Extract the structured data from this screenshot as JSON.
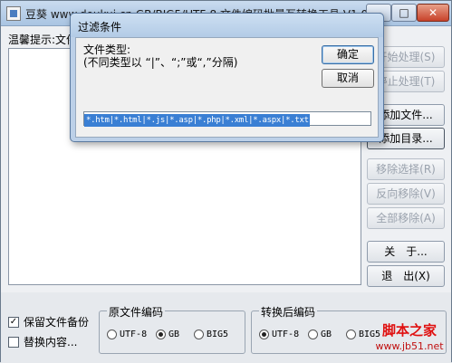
{
  "main_window": {
    "title": "豆葵 www.doukui.cn GB/BIG5/UTF-8 文件编码批量互转换工具 V1.0",
    "controls": {
      "minimize": "–",
      "maximize": "□",
      "close": "✕"
    },
    "hint_label": "温馨提示:文件",
    "side_buttons": [
      {
        "label": "开始处理(S)",
        "enabled": false
      },
      {
        "label": "停止处理(T)",
        "enabled": false
      },
      {
        "label": "添加文件...",
        "enabled": true
      },
      {
        "label": "添加目录...",
        "enabled": true
      },
      {
        "label": "移除选择(R)",
        "enabled": false
      },
      {
        "label": "反向移除(V)",
        "enabled": false
      },
      {
        "label": "全部移除(A)",
        "enabled": false
      },
      {
        "label": "关　于...",
        "enabled": true
      },
      {
        "label": "退　出(X)",
        "enabled": true
      }
    ],
    "options": {
      "backup": {
        "label": "保留文件备份",
        "checked": true
      },
      "replace": {
        "label": "替换内容...",
        "checked": false
      }
    },
    "source_encoding": {
      "title": "原文件编码",
      "options": [
        "UTF-8",
        "GB",
        "BIG5"
      ],
      "selected": "GB"
    },
    "target_encoding": {
      "title": "转换后编码",
      "options": [
        "UTF-8",
        "GB",
        "BIG5"
      ],
      "selected": "UTF-8"
    },
    "watermark": {
      "line1": "脚本之家",
      "line2": "www.jb51.net"
    }
  },
  "dialog": {
    "title": "过滤条件",
    "label_line1": "文件类型:",
    "label_line2": "(不同类型以 “|”、“;”或“,”分隔)",
    "ok_label": "确定",
    "cancel_label": "取消",
    "filter_value": "*.htm|*.html|*.js|*.asp|*.php|*.xml|*.aspx|*.txt"
  },
  "colors": {
    "selection": "#3a7fd4",
    "dialog_frame": "#bcd0e8",
    "watermark": "#e01010"
  }
}
